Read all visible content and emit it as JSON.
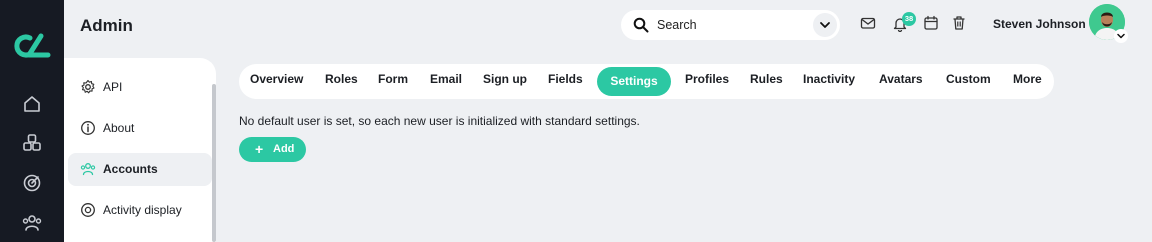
{
  "header": {
    "title": "Admin",
    "search": {
      "placeholder": "Search"
    },
    "notifications_count": "38",
    "user_name": "Steven Johnson"
  },
  "rail": {
    "icons": [
      "home-icon",
      "cubes-icon",
      "target-icon",
      "users-icon"
    ]
  },
  "settings_nav": {
    "items": [
      {
        "label": "API",
        "icon": "gear-icon"
      },
      {
        "label": "About",
        "icon": "info-icon"
      },
      {
        "label": "Accounts",
        "icon": "users-icon",
        "active": true
      },
      {
        "label": "Activity display",
        "icon": "target-icon"
      }
    ]
  },
  "tabs": [
    "Overview",
    "Roles",
    "Form",
    "Email",
    "Sign up",
    "Fields",
    "Settings",
    "Profiles",
    "Rules",
    "Inactivity",
    "Avatars",
    "Custom",
    "More"
  ],
  "active_tab": "Settings",
  "content": {
    "message": "No default user is set, so each new user is initialized with standard settings.",
    "add_label": "Add"
  },
  "colors": {
    "accent": "#2cc8a3",
    "rail": "#161a23",
    "background": "#eef0f3"
  }
}
